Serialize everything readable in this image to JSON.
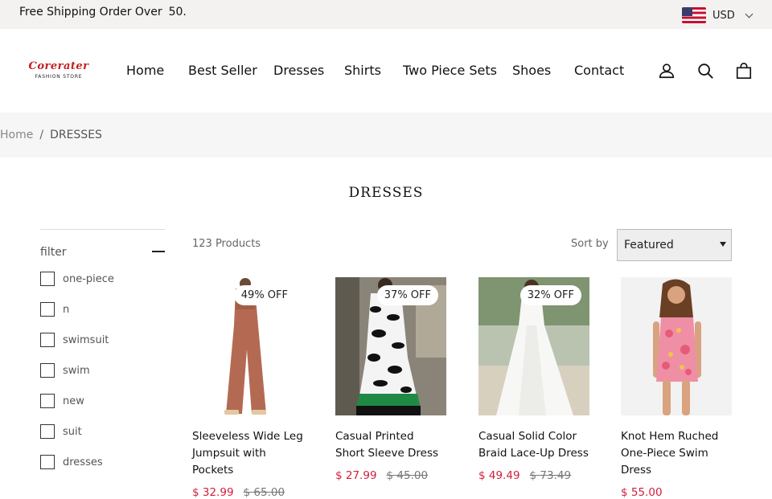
{
  "topbar": {
    "shipping_text": "Free Shipping Order Over",
    "shipping_amount": "50.",
    "currency": "USD"
  },
  "header": {
    "logo_brand": "Corerater",
    "logo_sub": "FASHION STORE",
    "nav": [
      "Home",
      "Best Seller",
      "Dresses",
      "Shirts",
      "Two Piece Sets",
      "Shoes",
      "Contact"
    ],
    "icons": [
      "account-icon",
      "search-icon",
      "cart-icon"
    ]
  },
  "breadcrumb": {
    "home": "Home",
    "separator": "/",
    "current": "DRESSES"
  },
  "page_title": "DRESSES",
  "filter": {
    "heading": "filter",
    "options": [
      "one-piece",
      "n",
      "swimsuit",
      "swim",
      "new",
      "suit",
      "dresses"
    ]
  },
  "toolbar": {
    "product_count": "123 Products",
    "sort_label": "Sort by",
    "sort_value": "Featured"
  },
  "products": [
    {
      "badge": "49% OFF",
      "name": "Sleeveless Wide Leg Jumpsuit with Pockets",
      "sale_price": "$ 32.99",
      "original_price": "$ 65.00"
    },
    {
      "badge": "37% OFF",
      "name": "Casual Printed Short Sleeve Dress",
      "sale_price": "$ 27.99",
      "original_price": "$ 45.00"
    },
    {
      "badge": "32% OFF",
      "name": "Casual Solid Color Braid Lace-Up Dress",
      "sale_price": "$ 49.49",
      "original_price": "$ 73.49"
    },
    {
      "badge": "",
      "name": "Knot Hem Ruched One-Piece Swim Dress",
      "sale_price": "$ 55.00",
      "original_price": ""
    }
  ],
  "colors": {
    "sale": "#d21d3c",
    "logo": "#c41e1e",
    "topbar_bg": "#f4f2f0"
  }
}
